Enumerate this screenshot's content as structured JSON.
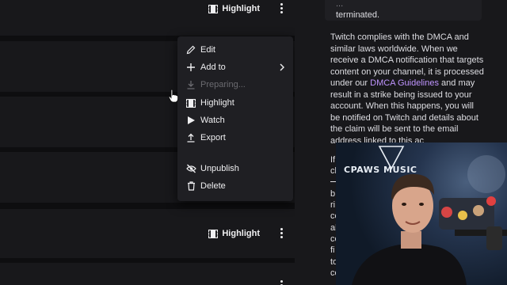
{
  "rows": [
    {
      "highlight_label": "Highlight",
      "show_highlight": true
    },
    {
      "highlight_label": "",
      "show_highlight": false
    },
    {
      "highlight_label": "",
      "show_highlight": false
    },
    {
      "highlight_label": "",
      "show_highlight": false
    },
    {
      "highlight_label": "Highlight",
      "show_highlight": true
    },
    {
      "highlight_label": "",
      "show_highlight": false
    }
  ],
  "menu": {
    "edit": "Edit",
    "add_to": "Add to",
    "preparing": "Preparing...",
    "highlight": "Highlight",
    "watch": "Watch",
    "export": "Export",
    "unpublish": "Unpublish",
    "delete": "Delete"
  },
  "side": {
    "notice_tail": "terminated.",
    "notice_prefix": "...",
    "para_1": "Twitch complies with the DMCA and similar laws worldwide. When we receive a DMCA notification that targets content on your channel, it is processed under our",
    "dmca_link": "DMCA Guidelines",
    "para_2": "and may result in a strike being issued to your account. When this happens, you will be notified on Twitch and details about the claim will be sent to the email address linked to this",
    "para_2_end": "ac",
    "cut_lines": [
      "If",
      "cl",
      "b",
      "ri",
      "co",
      "al",
      "co",
      "fi",
      "to",
      "co",
      "re"
    ]
  },
  "cam": {
    "logo_text": "CPAWS  MUSIC",
    "logo_letters": "CP"
  },
  "colors": {
    "bg": "#0e0e10",
    "panel": "#18181b",
    "menu": "#1f1f23",
    "link": "#bf94ff",
    "disabled": "#6b6b70"
  }
}
